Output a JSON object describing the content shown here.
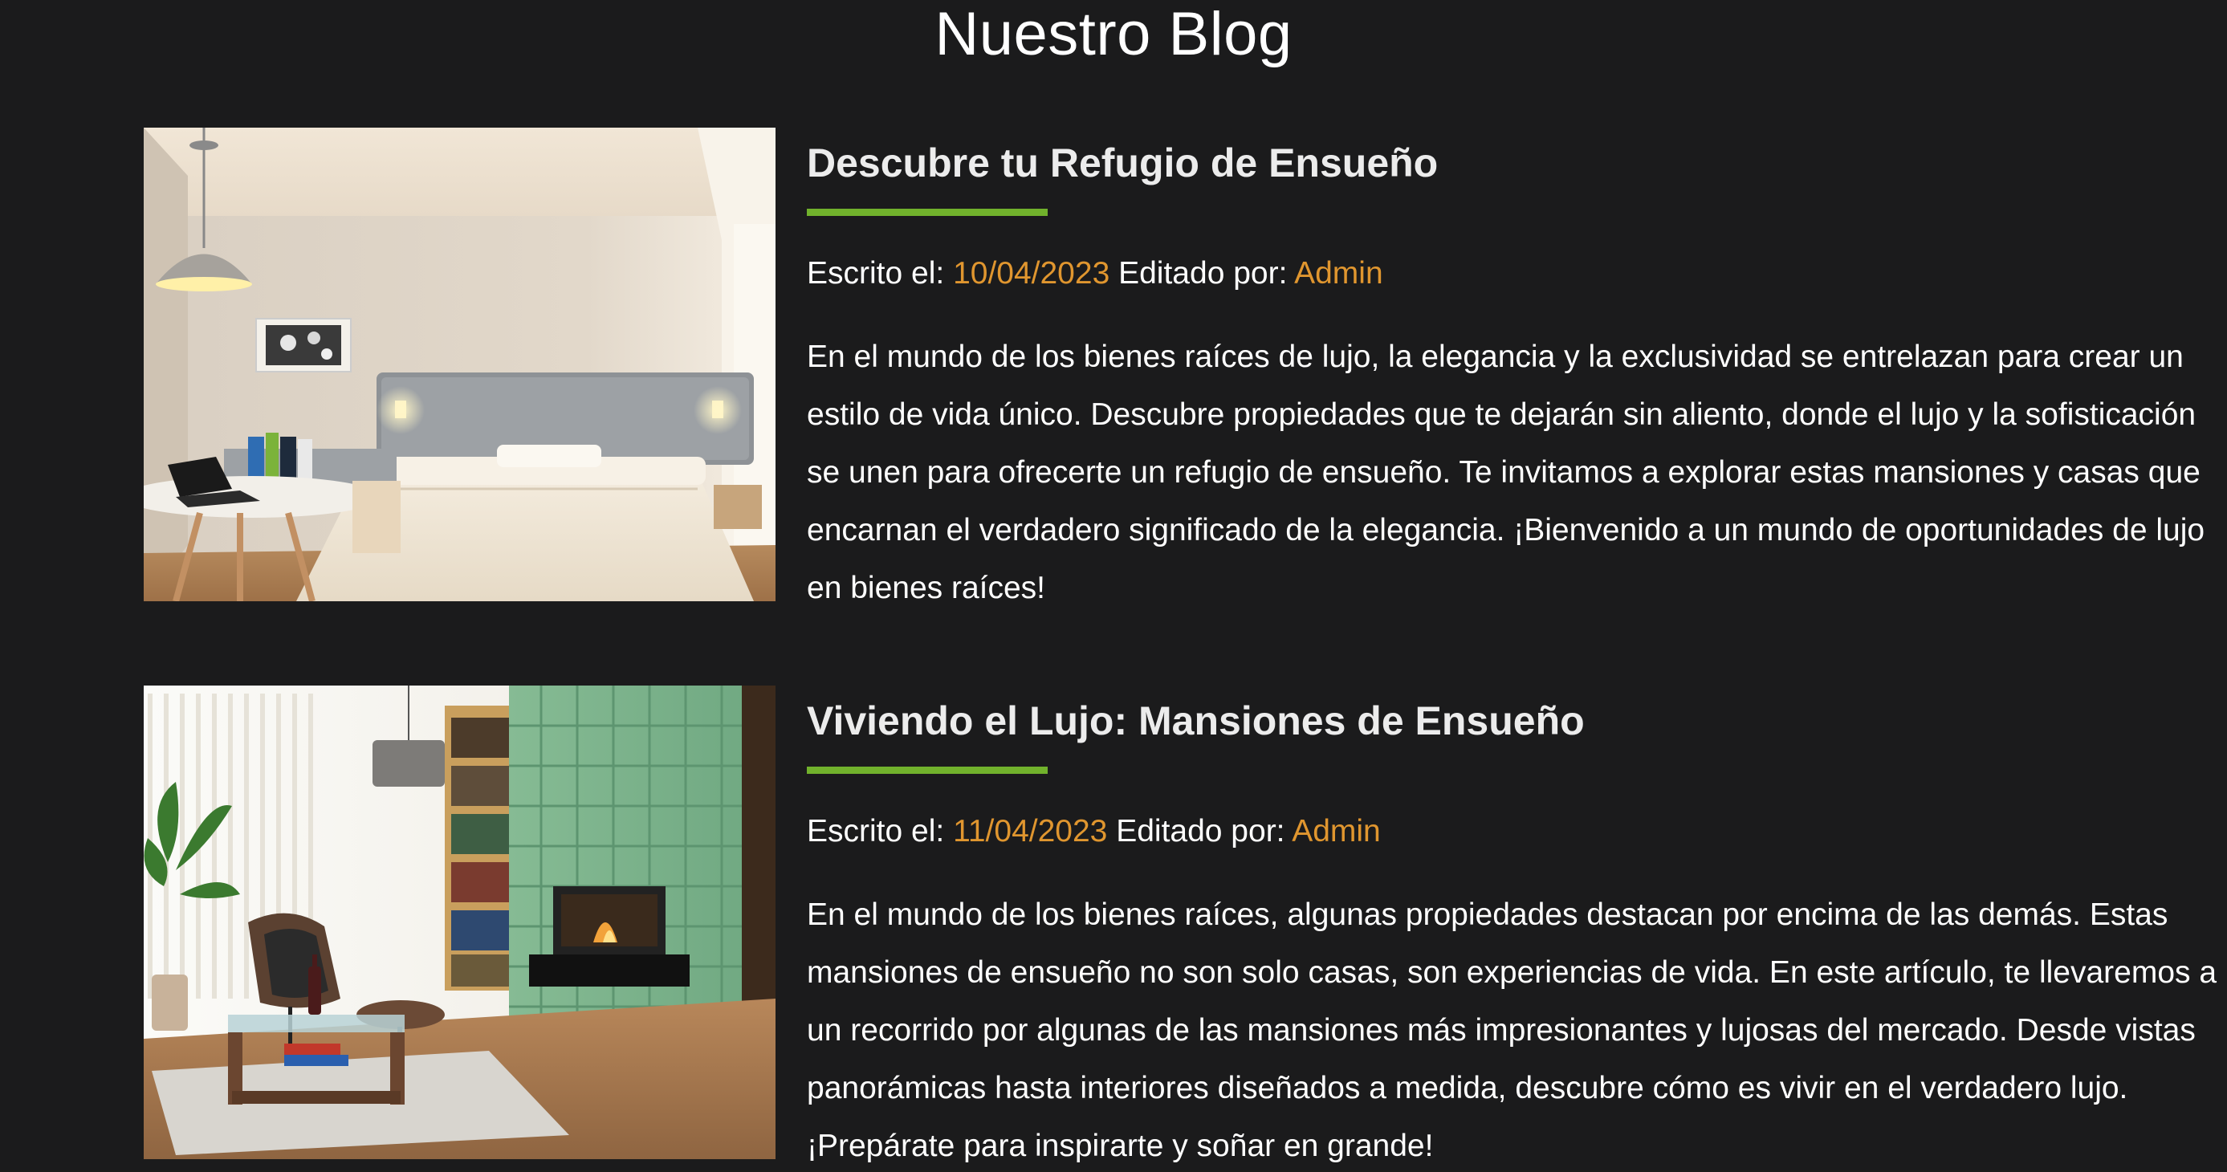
{
  "blog": {
    "title": "Nuestro Blog"
  },
  "colors": {
    "background": "#1b1b1c",
    "accent_underline": "#71b22c",
    "accent_text": "#e0962f",
    "text": "#ffffff"
  },
  "posts": [
    {
      "title": "Descubre tu Refugio de Ensueño",
      "written_label": "Escrito el:",
      "date": "10/04/2023",
      "edited_label": "Editado por:",
      "author": "Admin",
      "excerpt": "En el mundo de los bienes raíces de lujo, la elegancia y la exclusividad se entrelazan para crear un estilo de vida único. Descubre propiedades que te dejarán sin aliento, donde el lujo y la sofisticación se unen para ofrecerte un refugio de ensueño. Te invitamos a explorar estas mansiones y casas que encarnan el verdadero significado de la elegancia. ¡Bienvenido a un mundo de oportunidades de lujo en bienes raíces!",
      "image": "bedroom-photo"
    },
    {
      "title": "Viviendo el Lujo: Mansiones de Ensueño",
      "written_label": "Escrito el:",
      "date": "11/04/2023",
      "edited_label": "Editado por:",
      "author": "Admin",
      "excerpt": "En el mundo de los bienes raíces, algunas propiedades destacan por encima de las demás. Estas mansiones de ensueño no son solo casas, son experiencias de vida. En este artículo, te llevaremos a un recorrido por algunas de las mansiones más impresionantes y lujosas del mercado. Desde vistas panorámicas hasta interiores diseñados a medida, descubre cómo es vivir en el verdadero lujo. ¡Prepárate para inspirarte y soñar en grande!",
      "image": "living-room-photo"
    }
  ]
}
